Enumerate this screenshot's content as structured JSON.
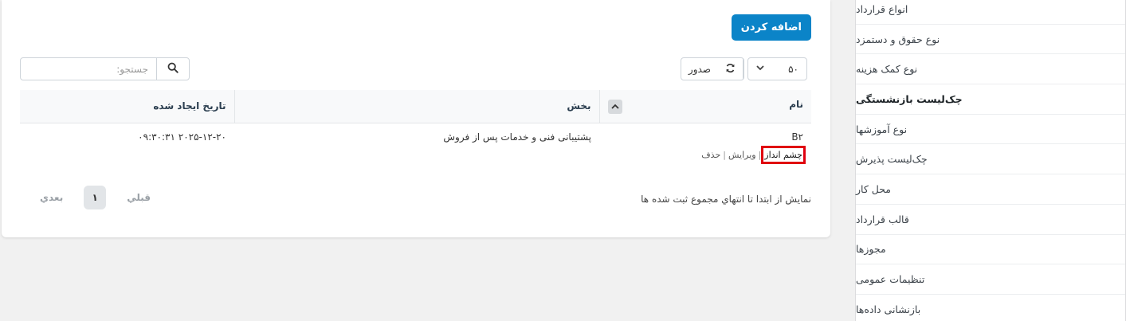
{
  "main": {
    "add_button": "اضافه کردن",
    "length_value": "۵۰",
    "export_label": "صدور",
    "search_placeholder": "جستجو:"
  },
  "table": {
    "headers": [
      "نام",
      "بخش",
      "تاریخ ایجاد شده"
    ],
    "rows": [
      {
        "name": "B۲",
        "section": "پشتیبانی فنی و خدمات پس از فروش",
        "date": "۲۰۲۵-۱۲-۲۰ ۰۹:۳۰:۳۱",
        "actions": {
          "view": "چشم انداز",
          "edit": "ویرایش",
          "delete": "حذف"
        }
      }
    ]
  },
  "footer": {
    "info": "نمایش از ابتدا تا انتهاي مجموع ثبت شده ها",
    "prev": "قبلي",
    "page": "۱",
    "next": "بعدي"
  },
  "sidebar": {
    "items": [
      {
        "label": "انواع قرارداد",
        "active": false
      },
      {
        "label": "نوع حقوق و دستمزد",
        "active": false
      },
      {
        "label": "نوع کمک هزینه",
        "active": false
      },
      {
        "label": "چک‌لیست بازنشستگی",
        "active": true
      },
      {
        "label": "نوع آموزشها",
        "active": false
      },
      {
        "label": "چک‌لیست پذیرش",
        "active": false
      },
      {
        "label": "محل کار",
        "active": false
      },
      {
        "label": "قالب قرارداد",
        "active": false
      },
      {
        "label": "مجوزها",
        "active": false
      },
      {
        "label": "تنظیمات عمومی",
        "active": false
      },
      {
        "label": "بازنشانی داده‌ها",
        "active": false
      }
    ]
  },
  "icons": {
    "search": "search-icon",
    "reload": "reload-icon",
    "sort": "chevron-up-icon",
    "dropdown": "chevron-down-icon"
  },
  "colors": {
    "primary": "#0b84c8",
    "highlight": "#e0000f"
  }
}
